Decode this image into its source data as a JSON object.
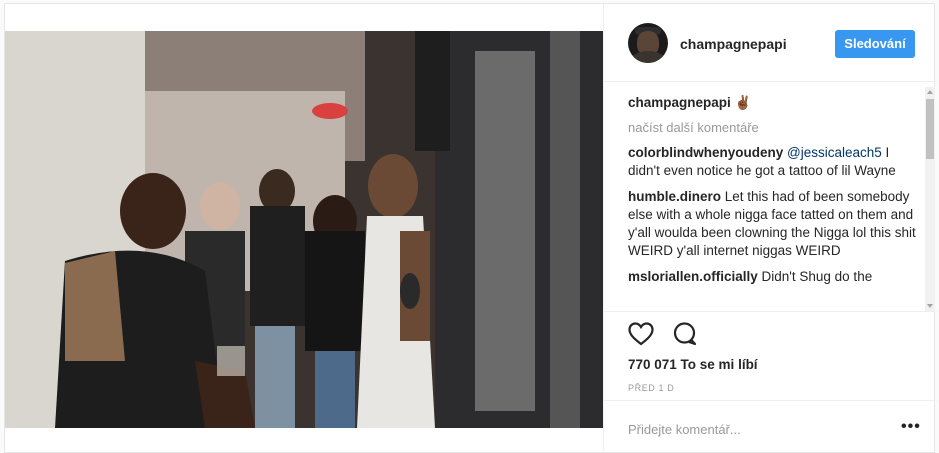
{
  "post": {
    "username": "champagnepapi",
    "follow_label": "Sledování",
    "caption_user": "champagnepapi",
    "caption_text": "✌🏾",
    "load_more": "načíst další komentáře",
    "comments": [
      {
        "user": "colorblindwhenyoudeny",
        "mention": "@jessicaleach5",
        "text": " I didn't even notice he got a tattoo of lil Wayne"
      },
      {
        "user": "humble.dinero",
        "mention": "",
        "text": " Let this had of been somebody else with a whole nigga face tatted on them and y'all woulda been clowning the Nigga lol this shit WEIRD y'all internet niggas WEIRD"
      },
      {
        "user": "msloriallen.officially",
        "mention": "",
        "text": " Didn't Shug do the"
      }
    ],
    "likes": "770 071 To se mi líbí",
    "date": "PŘED 1 D",
    "comment_placeholder": "Přidejte komentář...",
    "more_options": "•••"
  },
  "icons": {
    "like": "heart-icon",
    "comment": "comment-bubble-icon"
  }
}
